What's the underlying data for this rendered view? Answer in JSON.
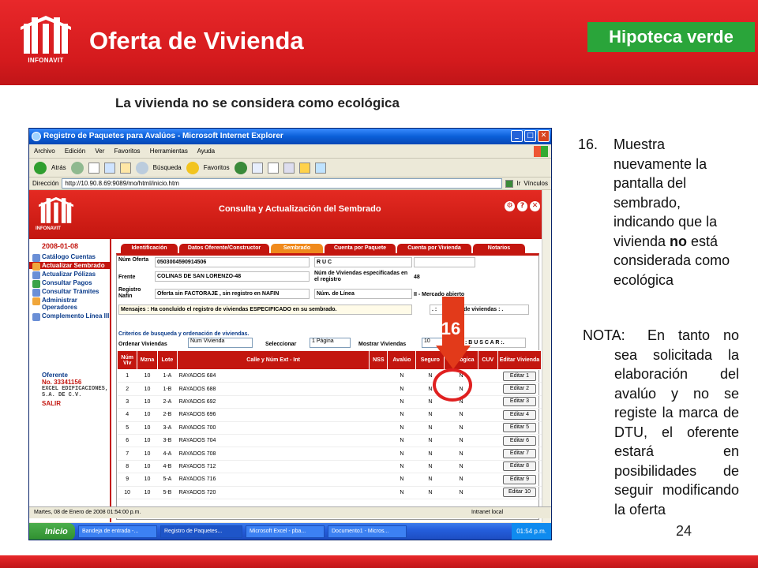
{
  "slide": {
    "logo_word": "INFONAVIT",
    "title": "Oferta de Vivienda",
    "badge": "Hipoteca verde",
    "subtitle": "La vivienda no se considera como ecológica",
    "page_number": "24"
  },
  "window": {
    "title": "Registro de Paquetes para Avalúos - Microsoft Internet Explorer",
    "menu": [
      "Archivo",
      "Edición",
      "Ver",
      "Favoritos",
      "Herramientas",
      "Ayuda"
    ],
    "toolbar": {
      "back": "Atrás",
      "search": "Búsqueda",
      "favorites": "Favoritos"
    },
    "address_label": "Dirección",
    "address": "http://10.90.8.69:9089/mo/html/inicio.htm",
    "go": "Ir",
    "links": "Vínculos",
    "status": "Martes, 08 de Enero de 2008 01:54:00 p.m.",
    "zone": "Intranet local"
  },
  "taskbar": {
    "start": "Inicio",
    "tasks": [
      "Bandeja de entrada -...",
      "Registro de Paquetes...",
      "Microsoft Excel - pba...",
      "Documento1 - Micros..."
    ],
    "clock": "01:54 p.m."
  },
  "app": {
    "logo_word": "INFONAVIT",
    "title": "Consulta y Actualización del Sembrado",
    "date": "2008-01-08",
    "menu": [
      "Catálogo Cuentas",
      "Actualizar Sembrado",
      "Actualizar Pólizas",
      "Consultar Pagos",
      "Consultar Trámites",
      "Administrar Operadores",
      "Complemento Línea III"
    ],
    "oferente_label": "Oferente",
    "oferente_no": "No. 33341156",
    "oferente_name": "EXCEL EDIFICACIONES, S.A. DE C.V.",
    "salir": "SALIR",
    "tabs": [
      "Identificación",
      "Datos Oferente/Constructor",
      "Sembrado",
      "Cuenta por Paquete",
      "Cuenta por Vivienda",
      "Notarios"
    ],
    "form": {
      "num_oferta_label": "Núm Oferta",
      "num_oferta": "0503004590914506",
      "ruc_label": "R U C",
      "frente_label": "Frente",
      "frente": "COLINAS DE SAN LORENZO-48",
      "num_viviendas_label": "Núm de Viviendas especificadas en el registro",
      "num_viviendas": "48",
      "registro_label": "Registro Nafin",
      "registro": "Oferta sin FACTORAJE , sin registro en NAFIN",
      "linea_label": "Núm. de Línea",
      "linea": "II - Mercado abierto",
      "mensajes_label": "Mensajes :",
      "mensajes": "Ha concluido el registro de viviendas ESPECIFICADO en su sembrado.",
      "mensajes_right": ". : ",
      "mensajes_right2": "de viviendas : ."
    },
    "criteria_title": "Criterios de busqueda y ordenación de viviendas.",
    "ordenar_label": "Ordenar Viviendas",
    "ordenar_value": "Num Vivienda",
    "seleccionar_label": "Seleccionar",
    "seleccionar_value": "1 Página",
    "mostrar_label": "Mostrar Viviendas",
    "mostrar_value": "10",
    "buscar": ": B U S C A R :.",
    "columns": [
      "Núm Viv",
      "Mzna",
      "Lote",
      "Calle y Núm Ext - Int",
      "NSS",
      "Avalúo",
      "Seguro",
      "Ecológica",
      "CUV",
      "Editar Vivienda"
    ],
    "rows": [
      {
        "viv": "1",
        "mzna": "10",
        "lote": "1-A",
        "calle": "RAYADOS 684",
        "nss": "",
        "avaluo": "N",
        "seguro": "N",
        "eco": "N",
        "cuv": "",
        "edit": "Editar 1"
      },
      {
        "viv": "2",
        "mzna": "10",
        "lote": "1-B",
        "calle": "RAYADOS 688",
        "nss": "",
        "avaluo": "N",
        "seguro": "N",
        "eco": "N",
        "cuv": "",
        "edit": "Editar 2"
      },
      {
        "viv": "3",
        "mzna": "10",
        "lote": "2-A",
        "calle": "RAYADOS 692",
        "nss": "",
        "avaluo": "N",
        "seguro": "N",
        "eco": "N",
        "cuv": "",
        "edit": "Editar 3"
      },
      {
        "viv": "4",
        "mzna": "10",
        "lote": "2-B",
        "calle": "RAYADOS 696",
        "nss": "",
        "avaluo": "N",
        "seguro": "N",
        "eco": "N",
        "cuv": "",
        "edit": "Editar 4"
      },
      {
        "viv": "5",
        "mzna": "10",
        "lote": "3-A",
        "calle": "RAYADOS 700",
        "nss": "",
        "avaluo": "N",
        "seguro": "N",
        "eco": "N",
        "cuv": "",
        "edit": "Editar 5"
      },
      {
        "viv": "6",
        "mzna": "10",
        "lote": "3-B",
        "calle": "RAYADOS 704",
        "nss": "",
        "avaluo": "N",
        "seguro": "N",
        "eco": "N",
        "cuv": "",
        "edit": "Editar 6"
      },
      {
        "viv": "7",
        "mzna": "10",
        "lote": "4-A",
        "calle": "RAYADOS 708",
        "nss": "",
        "avaluo": "N",
        "seguro": "N",
        "eco": "N",
        "cuv": "",
        "edit": "Editar 7"
      },
      {
        "viv": "8",
        "mzna": "10",
        "lote": "4-B",
        "calle": "RAYADOS 712",
        "nss": "",
        "avaluo": "N",
        "seguro": "N",
        "eco": "N",
        "cuv": "",
        "edit": "Editar 8"
      },
      {
        "viv": "9",
        "mzna": "10",
        "lote": "5-A",
        "calle": "RAYADOS 716",
        "nss": "",
        "avaluo": "N",
        "seguro": "N",
        "eco": "N",
        "cuv": "",
        "edit": "Editar 9"
      },
      {
        "viv": "10",
        "mzna": "10",
        "lote": "5-B",
        "calle": "RAYADOS 720",
        "nss": "",
        "avaluo": "N",
        "seguro": "N",
        "eco": "N",
        "cuv": "",
        "edit": "Editar 10"
      }
    ]
  },
  "annotation": {
    "step_badge": "16"
  },
  "instructions": {
    "step_num": "16.",
    "step_pre": "Muestra nuevamente la pantalla del sembrado, indicando que la vivienda ",
    "step_bold": "no",
    "step_post": " está considerada como ecológica",
    "nota_label": "NOTA:",
    "nota_text": "En tanto no sea solicitada la elaboración del avalúo y no se registe la marca de DTU, el oferente estará en posibilidades de seguir modificando la oferta"
  },
  "colors": {
    "brand_red": "#d41a1d",
    "badge_green": "#2aa53a",
    "annotation_red": "#e02020"
  }
}
